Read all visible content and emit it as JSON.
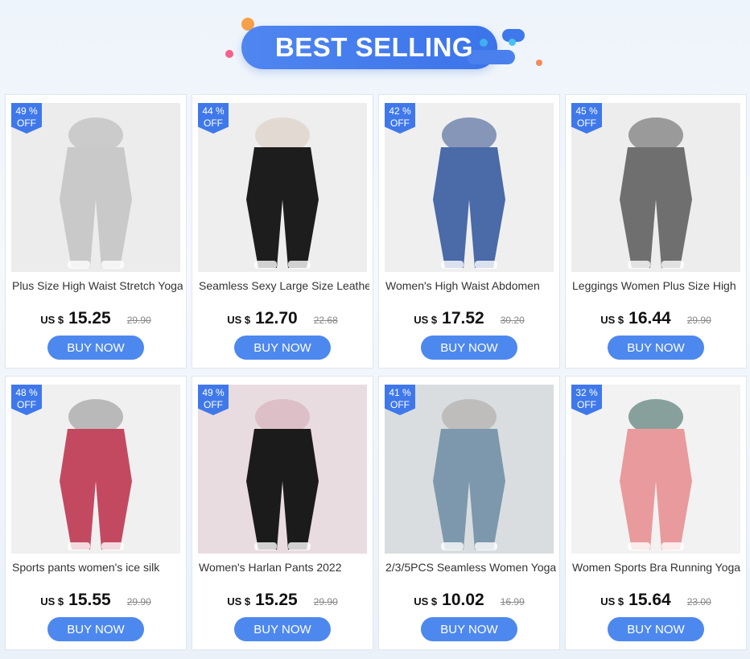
{
  "banner": {
    "title": "BEST SELLING"
  },
  "currency_label": "US $",
  "products": [
    {
      "discount_pct": "49 %",
      "off": "OFF",
      "name": "Plus Size High Waist Stretch Yoga",
      "price": "15.25",
      "original_price": "29.90",
      "buy": "BUY NOW",
      "palette": [
        "#ececec",
        "#c9c9c9",
        "#b0b0b0"
      ]
    },
    {
      "discount_pct": "44 %",
      "off": "OFF",
      "name": "Seamless Sexy Large Size Leather",
      "price": "12.70",
      "original_price": "22.68",
      "buy": "BUY NOW",
      "palette": [
        "#eeeeee",
        "#1d1d1d",
        "#d9c8bd"
      ]
    },
    {
      "discount_pct": "42 %",
      "off": "OFF",
      "name": "Women's High Waist Abdomen",
      "price": "17.52",
      "original_price": "30.20",
      "buy": "BUY NOW",
      "palette": [
        "#efefef",
        "#4a6aa8",
        "#2f4d8a"
      ]
    },
    {
      "discount_pct": "45 %",
      "off": "OFF",
      "name": "Leggings Women Plus Size High",
      "price": "16.44",
      "original_price": "29.90",
      "buy": "BUY NOW",
      "palette": [
        "#ededed",
        "#6f6f6f",
        "#555555"
      ]
    },
    {
      "discount_pct": "48 %",
      "off": "OFF",
      "name": "Sports pants women's ice silk",
      "price": "15.55",
      "original_price": "29.90",
      "buy": "BUY NOW",
      "palette": [
        "#f0f0f0",
        "#c34961",
        "#8d8d8d"
      ]
    },
    {
      "discount_pct": "49 %",
      "off": "OFF",
      "name": "Women's Harlan Pants 2022",
      "price": "15.25",
      "original_price": "29.90",
      "buy": "BUY NOW",
      "palette": [
        "#e9dce0",
        "#1b1b1b",
        "#d4a7b3"
      ]
    },
    {
      "discount_pct": "41 %",
      "off": "OFF",
      "name": "2/3/5PCS Seamless Women Yoga",
      "price": "10.02",
      "original_price": "16.99",
      "buy": "BUY NOW",
      "palette": [
        "#d9dde0",
        "#7d98ad",
        "#a9a39c"
      ]
    },
    {
      "discount_pct": "32 %",
      "off": "OFF",
      "name": "Women Sports Bra Running Yoga",
      "price": "15.64",
      "original_price": "23.00",
      "buy": "BUY NOW",
      "palette": [
        "#f2f2f2",
        "#e99a9c",
        "#2f5c53"
      ]
    }
  ]
}
